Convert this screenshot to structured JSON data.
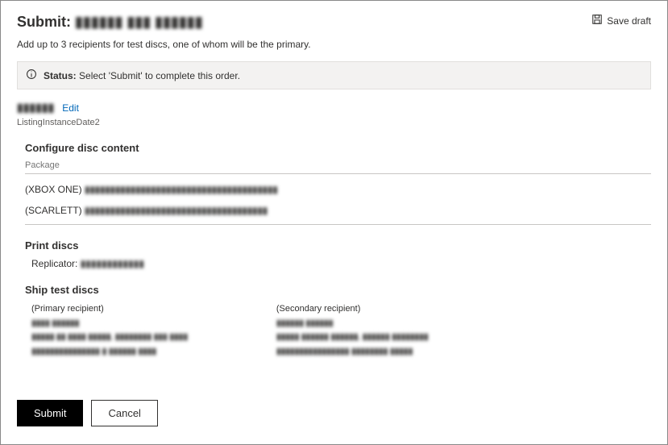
{
  "header": {
    "title_prefix": "Submit:",
    "title_name": "▮▮▮▮▮▮ ▮▮▮ ▮▮▮▮▮▮",
    "save_draft": "Save draft"
  },
  "subtitle": "Add up to 3 recipients for test discs, one of whom will be the primary.",
  "status": {
    "label": "Status:",
    "text": "Select 'Submit' to complete this order."
  },
  "listing": {
    "name": "▮▮▮▮▮▮",
    "edit": "Edit",
    "date": "ListingInstanceDate2"
  },
  "configure": {
    "title": "Configure disc content",
    "package_header": "Package",
    "rows": [
      {
        "platform": "(XBOX ONE)",
        "desc": "▮▮▮▮▮▮▮▮▮▮▮▮▮▮▮▮▮▮▮▮▮▮▮▮▮▮▮▮▮▮▮▮▮▮▮▮▮▮"
      },
      {
        "platform": "(SCARLETT)",
        "desc": "▮▮▮▮▮▮▮▮▮▮▮▮▮▮▮▮▮▮▮▮▮▮▮▮▮▮▮▮▮▮▮▮▮▮▮▮"
      }
    ]
  },
  "print": {
    "title": "Print discs",
    "replicator_label": "Replicator:",
    "replicator_value": "▮▮▮▮▮▮▮▮▮▮▮▮"
  },
  "ship": {
    "title": "Ship test discs",
    "primary": {
      "heading": "(Primary recipient)",
      "name": "▮▮▮▮ ▮▮▮▮▮▮",
      "addr": "▮▮▮▮▮ ▮▮ ▮▮▮▮ ▮▮▮▮▮, ▮▮▮▮▮▮▮▮ ▮▮▮ ▮▮▮▮",
      "contact": "▮▮▮▮▮▮▮▮▮▮▮▮▮▮▮ ▮ ▮▮▮▮▮▮ ▮▮▮▮"
    },
    "secondary": {
      "heading": "(Secondary recipient)",
      "name": "▮▮▮▮▮▮ ▮▮▮▮▮▮",
      "addr": "▮▮▮▮▮ ▮▮▮▮▮▮ ▮▮▮▮▮▮, ▮▮▮▮▮▮ ▮▮▮▮▮▮▮▮",
      "contact": "▮▮▮▮▮▮▮▮▮▮▮▮▮▮▮▮  ▮▮▮▮▮▮▮▮ ▮▮▮▮▮"
    }
  },
  "buttons": {
    "submit": "Submit",
    "cancel": "Cancel"
  }
}
